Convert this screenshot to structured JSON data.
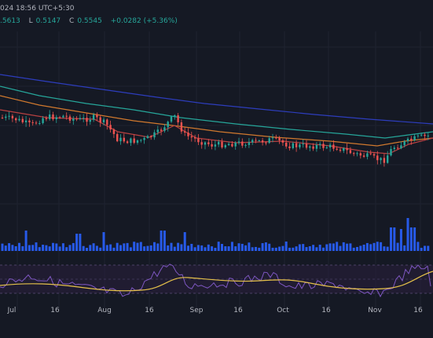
{
  "header": {
    "datetime_fragment": "024 18:56 UTC+5:30",
    "ohlc_fragment": [
      {
        "key": "",
        "value": ".5613"
      },
      {
        "key": "L",
        "value": "0.5147"
      },
      {
        "key": "C",
        "value": "0.5545"
      },
      {
        "key": "",
        "value": "+0.0282 (+5.36%)"
      }
    ]
  },
  "colors": {
    "background": "#151924",
    "up": "#26a69a",
    "down": "#ef5350",
    "ma_long": "#2d3dbd",
    "ma_mid": "#26a69a",
    "ma_short": "#d1792e",
    "ma_fast": "#b84141",
    "volume": "#2962ff",
    "rsi_line": "#7e57c2",
    "rsi_ma": "#e5c14a",
    "rsi_band": "#2a1f3d",
    "grid": "#1f2330"
  },
  "chart_data": {
    "type": "candlestick",
    "x_tick_labels": [
      "Jul",
      "16",
      "Aug",
      "16",
      "Sep",
      "16",
      "Oct",
      "16",
      "Nov",
      "16"
    ],
    "grid": true,
    "indicators": [
      "moving averages",
      "volume",
      "RSI"
    ]
  }
}
